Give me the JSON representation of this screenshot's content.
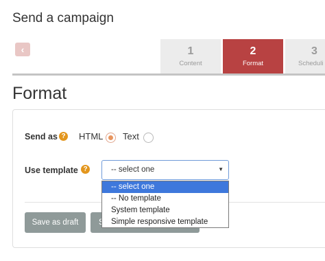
{
  "header": {
    "title": "Send a campaign"
  },
  "steps": [
    {
      "num": "1",
      "label": "Content"
    },
    {
      "num": "2",
      "label": "Format"
    },
    {
      "num": "3",
      "label": "Scheduli"
    }
  ],
  "section": {
    "title": "Format"
  },
  "form": {
    "send_as_label": "Send as",
    "html_label": "HTML",
    "text_label": "Text",
    "selected_format": "HTML",
    "use_template_label": "Use template",
    "template_select_value": "-- select one",
    "template_options": [
      "-- select one",
      "-- No template",
      "System template",
      "Simple responsive template"
    ],
    "help_glyph": "?"
  },
  "actions": {
    "save_draft_label": "Save as draft",
    "next_label_partial": "S"
  },
  "colors": {
    "active_step": "#b84242",
    "help_icon": "#e3961d",
    "radio_checked": "#e8955f",
    "button": "#8f9a99",
    "dropdown_highlight": "#3e78dc"
  }
}
